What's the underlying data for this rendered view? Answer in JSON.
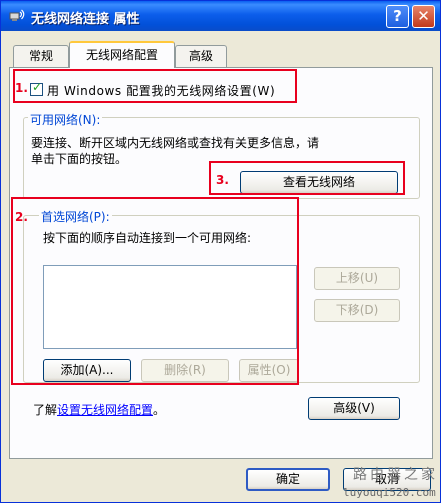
{
  "window": {
    "title": "无线网络连接 属性",
    "help_label": "?",
    "close_label": "✕"
  },
  "tabs": [
    {
      "label": "常规"
    },
    {
      "label": "无线网络配置",
      "active": true
    },
    {
      "label": "高级"
    }
  ],
  "config": {
    "checkbox_label": "用 Windows 配置我的无线网络设置(W)",
    "checked": true
  },
  "available": {
    "legend": "可用网络(N):",
    "desc_line1": "要连接、断开区域内无线网络或查找有关更多信息，请",
    "desc_line2": "单击下面的按钮。",
    "view_button": "查看无线网络"
  },
  "preferred": {
    "legend": "首选网络(P):",
    "desc": "按下面的顺序自动连接到一个可用网络:",
    "move_up": "上移(U)",
    "move_down": "下移(D)",
    "add": "添加(A)...",
    "remove": "删除(R)",
    "properties": "属性(O)"
  },
  "learn": {
    "prefix": "了解",
    "link": "设置无线网络配置",
    "suffix": "。"
  },
  "advanced_button": "高级(V)",
  "footer": {
    "ok": "确定",
    "cancel": "取消"
  },
  "annotations": [
    "1.",
    "2.",
    "3."
  ],
  "watermark": {
    "line1": "路由器之家",
    "line2": "luyouqi520.com"
  },
  "colors": {
    "annotation": "#E8001E",
    "titlebar": "#0C5EEB",
    "link": "#0000FF",
    "legend": "#0046D5"
  }
}
